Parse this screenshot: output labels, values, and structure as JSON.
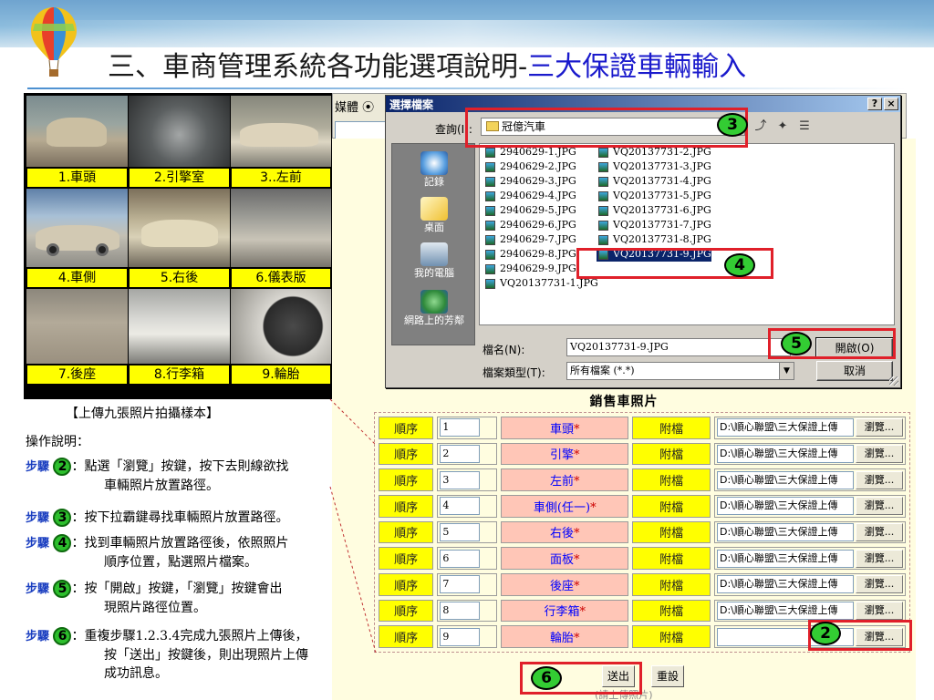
{
  "slide": {
    "title_main": "三、車商管理系統各功能選項說明-",
    "title_highlight": "三大保證車輛輸入"
  },
  "colors": {
    "title_highlight": "#1a1acc",
    "step_label": "#1a3ec0",
    "annotation_box": "#e0202a",
    "badge_fill": "#33cc33",
    "photo_label_bg": "#ffff00",
    "form_label_bg": "#ffff00",
    "form_field_bg": "#ffc6b7",
    "form_panel_bg": "#fffde0",
    "dialog_titlebar": "#0a246a"
  },
  "photo_grid": {
    "labels": [
      "1.車頭",
      "2.引擎室",
      "3..左前",
      "4.車側",
      "5.右後",
      "6.儀表版",
      "7.後座",
      "8.行李箱",
      "9.輪胎"
    ],
    "caption": "【上傳九張照片拍攝樣本】"
  },
  "instructions": {
    "title": "操作說明：",
    "step_label": "步驟",
    "steps": [
      {
        "num": "2",
        "line1": "：點選「瀏覽」按鍵，按下去則線欲找",
        "line2": "車輛照片放置路徑。"
      },
      {
        "num": "3",
        "line1": "：按下拉霸鍵尋找車輛照片放置路徑。",
        "line2": ""
      },
      {
        "num": "4",
        "line1": "：找到車輛照片放置路徑後，依照照片",
        "line2": "順序位置，點選照片檔案。"
      },
      {
        "num": "5",
        "line1": "：按「開啟」按鍵，「瀏覽」按鍵會出",
        "line2": "現照片路徑位置。"
      },
      {
        "num": "6",
        "line1": "：重複步驟1.2.3.4完成九張照片上傳後，",
        "line2": "按「送出」按鍵後，則出現照片上傳",
        "line3": "成功訊息。"
      }
    ]
  },
  "browser": {
    "media_label": "媒體"
  },
  "file_dialog": {
    "title": "選擇檔案",
    "help_button": "?",
    "close_button": "×",
    "look_in_label": "查詢(I):",
    "look_in_value": "冠億汽車",
    "places": [
      "記錄",
      "桌面",
      "我的電腦",
      "網路上的芳鄰"
    ],
    "files_col1": [
      "2940629-1.JPG",
      "2940629-2.JPG",
      "2940629-3.JPG",
      "2940629-4.JPG",
      "2940629-5.JPG",
      "2940629-6.JPG",
      "2940629-7.JPG",
      "2940629-8.JPG",
      "2940629-9.JPG",
      "VQ20137731-1.JPG"
    ],
    "files_col2": [
      "VQ20137731-2.JPG",
      "VQ20137731-3.JPG",
      "VQ20137731-4.JPG",
      "VQ20137731-5.JPG",
      "VQ20137731-6.JPG",
      "VQ20137731-7.JPG",
      "VQ20137731-8.JPG",
      "VQ20137731-9.JPG"
    ],
    "selected_file": "VQ20137731-9.JPG",
    "filename_label": "檔名(N):",
    "filename_value": "VQ20137731-9.JPG",
    "filetype_label": "檔案類型(T):",
    "filetype_value": "所有檔案 (*.*)",
    "open_button": "開啟(O)",
    "cancel_button": "取消"
  },
  "upload_form": {
    "title": "銷售車照片",
    "order_label": "順序",
    "attach_label": "附檔",
    "browse_label": "瀏覽...",
    "rows": [
      {
        "order": "1",
        "field": "車頭",
        "path": "D:\\順心聯盟\\三大保證上傳"
      },
      {
        "order": "2",
        "field": "引擎",
        "path": "D:\\順心聯盟\\三大保證上傳"
      },
      {
        "order": "3",
        "field": "左前",
        "path": "D:\\順心聯盟\\三大保證上傳"
      },
      {
        "order": "4",
        "field": "車側(任一)",
        "path": "D:\\順心聯盟\\三大保證上傳"
      },
      {
        "order": "5",
        "field": "右後",
        "path": "D:\\順心聯盟\\三大保證上傳"
      },
      {
        "order": "6",
        "field": "面板",
        "path": "D:\\順心聯盟\\三大保證上傳"
      },
      {
        "order": "7",
        "field": "後座",
        "path": "D:\\順心聯盟\\三大保證上傳"
      },
      {
        "order": "8",
        "field": "行李箱",
        "path": "D:\\順心聯盟\\三大保證上傳"
      },
      {
        "order": "9",
        "field": "輪胎",
        "path": ""
      }
    ],
    "required_mark": "*",
    "submit_button": "送出",
    "reset_button": "重設",
    "footer_text": "(請上傳照片)"
  },
  "annotations": [
    "3",
    "4",
    "5",
    "2",
    "6"
  ]
}
